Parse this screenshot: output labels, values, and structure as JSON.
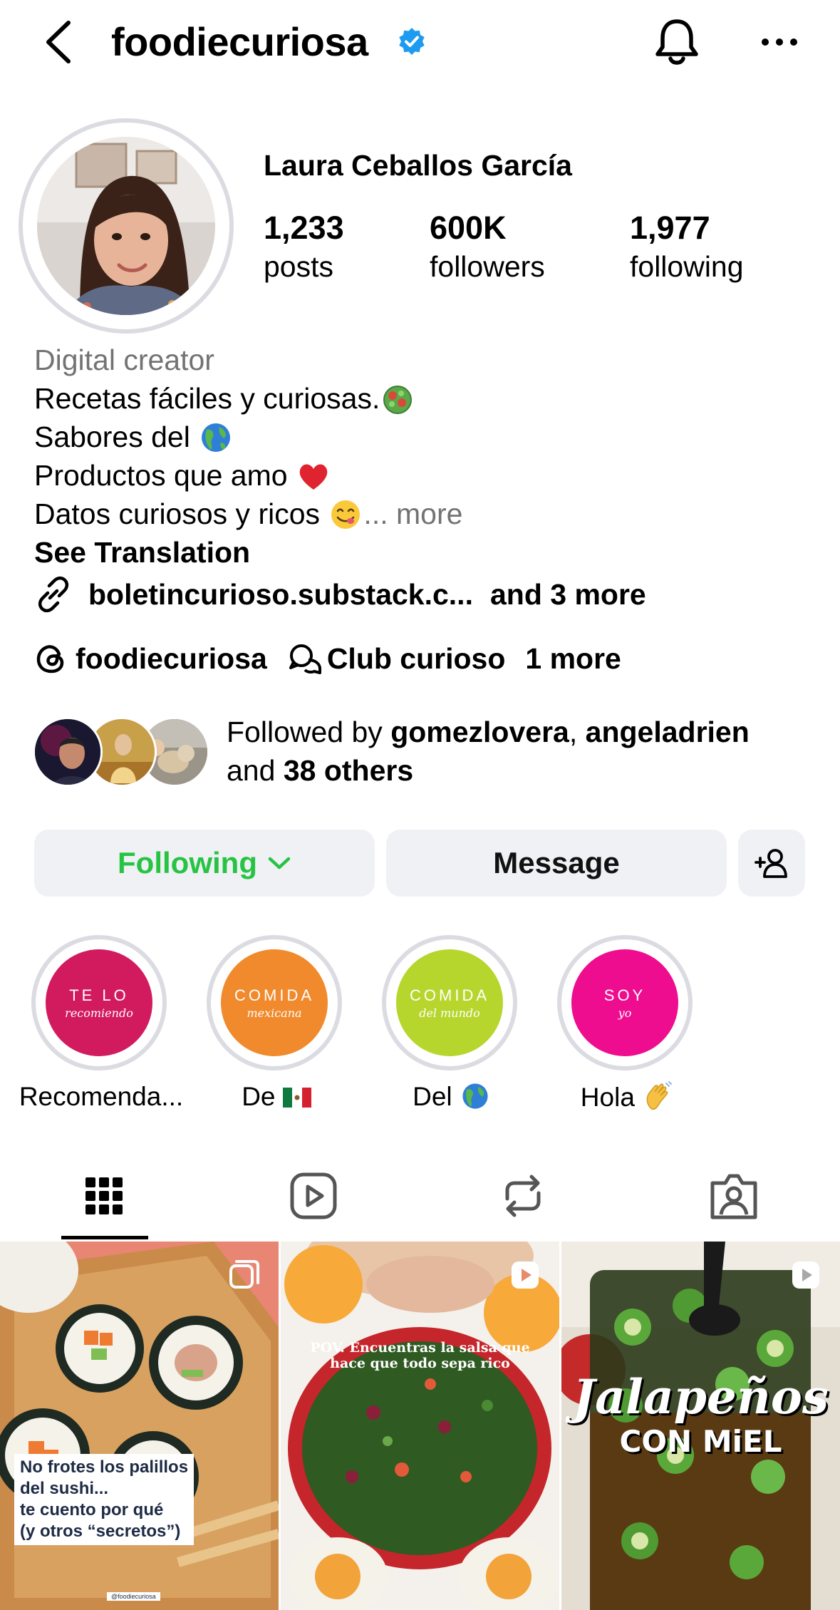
{
  "header": {
    "username": "foodiecuriosa"
  },
  "profile": {
    "full_name": "Laura Ceballos García",
    "stats": [
      {
        "value": "1,233",
        "label": "posts"
      },
      {
        "value": "600K",
        "label": "followers"
      },
      {
        "value": "1,977",
        "label": "following"
      }
    ],
    "category": "Digital creator",
    "bio_lines": [
      "Recetas fáciles y curiosas.",
      "Sabores del",
      "Productos que amo",
      "Datos curiosos y ricos"
    ],
    "bio_more": "... more",
    "see_translation": "See Translation",
    "link": {
      "text": "boletincurioso.substack.c...",
      "more": "and 3 more"
    },
    "threads": {
      "handle": "foodiecuriosa",
      "channel": "Club curioso",
      "more": "1 more"
    },
    "followed_by": {
      "prefix": "Followed by",
      "user1": "gomezlovera",
      "sep": ",",
      "user2": "angeladrien",
      "and": "and",
      "others": "38 others"
    }
  },
  "actions": {
    "following_label": "Following",
    "message_label": "Message"
  },
  "highlights": [
    {
      "t1": "TE LO",
      "t2": "recomiendo",
      "label": "Recomenda...",
      "color": "#d21a5f"
    },
    {
      "t1": "COMIDA",
      "t2": "mexicana",
      "label": "De",
      "color": "#f08a2c"
    },
    {
      "t1": "COMIDA",
      "t2": "del mundo",
      "label": "Del",
      "color": "#b6d62e"
    },
    {
      "t1": "SOY",
      "t2": "yo",
      "label": "Hola",
      "color": "#ee0c8f"
    }
  ],
  "posts": [
    {
      "caption": "No frotes los palillos del sushi... te cuento por qué (y otros “secretos”)",
      "lines": [
        "No frotes los palillos",
        "del sushi...",
        "te cuento por qué",
        "(y otros “secretos”)"
      ],
      "watermark": "@foodiecuriosa",
      "type": "carousel"
    },
    {
      "caption": "POV. Encuentras la salsa que hace que todo sepa rico",
      "lines": [
        "POV. Encuentras la salsa que",
        "hace que todo sepa rico"
      ],
      "type": "reel"
    },
    {
      "caption": "Jalapeños CON MiEL",
      "lines": [
        "Jalapeños",
        "CON MiEL"
      ],
      "type": "reel"
    }
  ],
  "colors": {
    "following_green": "#27c343",
    "verified_blue": "#1d9bf0",
    "muted_gray": "#737373",
    "button_bg": "#eff1f5"
  }
}
